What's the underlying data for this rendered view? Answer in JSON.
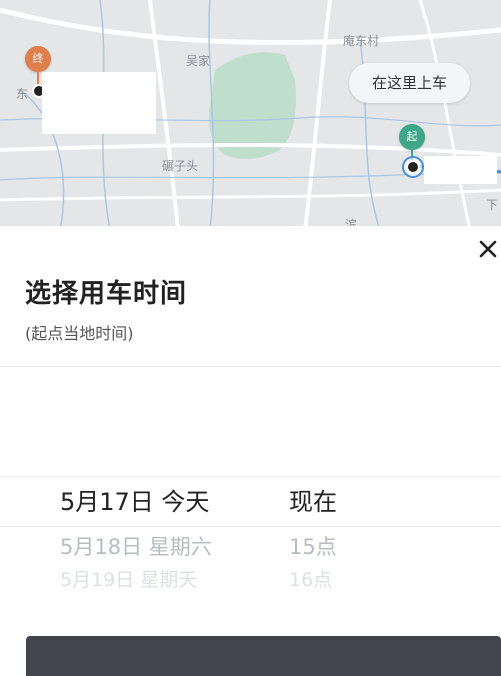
{
  "map": {
    "labels": {
      "wujia": "吴家",
      "yandongcun": "庵东村",
      "bianzitou": "碾子头",
      "dong": "东",
      "xia": "下",
      "partial_bottom": "滨"
    },
    "end_pin": "终",
    "start_pin": "起",
    "bubble_text": "在这里上车",
    "colors": {
      "end_pin": "#e07f4e",
      "start_pin": "#3fa689",
      "route": "#4a90d9",
      "park": "#b7dcc4"
    }
  },
  "sheet": {
    "close_icon": "close-icon",
    "title": "选择用车时间",
    "subtitle": "(起点当地时间)",
    "picker": {
      "selected": {
        "date": "5月17日 今天",
        "time": "现在"
      },
      "next": {
        "date": "5月18日 星期六",
        "time": "15点"
      },
      "next2": {
        "date": "5月19日 星期天",
        "time": "16点"
      }
    }
  }
}
